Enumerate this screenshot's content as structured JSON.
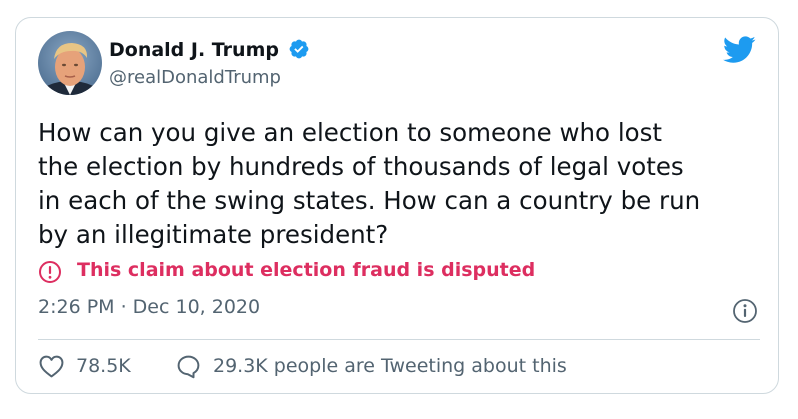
{
  "tweet": {
    "author_name": "Donald J. Trump",
    "handle": "@realDonaldTrump",
    "text_lines": [
      "How can you give an election to someone who lost",
      "the election by hundreds of thousands of legal votes",
      "in each of the swing states. How can a country be run",
      "by an illegitimate president?"
    ],
    "warning": "This claim about election fraud is disputed",
    "timestamp": "2:26 PM · Dec 10, 2020",
    "likes": "78.5K",
    "conversation": "29.3K people are Tweeting about this"
  },
  "icons": {
    "verified": "verified-badge-icon",
    "logo": "twitter-bird-icon",
    "warning": "alert-circle-icon",
    "info": "info-icon",
    "like": "heart-icon",
    "reply": "speech-bubble-icon"
  },
  "colors": {
    "brand": "#1d9bf0",
    "warning": "#dd2e60",
    "secondary_text": "#536471",
    "border": "#cfd9de"
  }
}
